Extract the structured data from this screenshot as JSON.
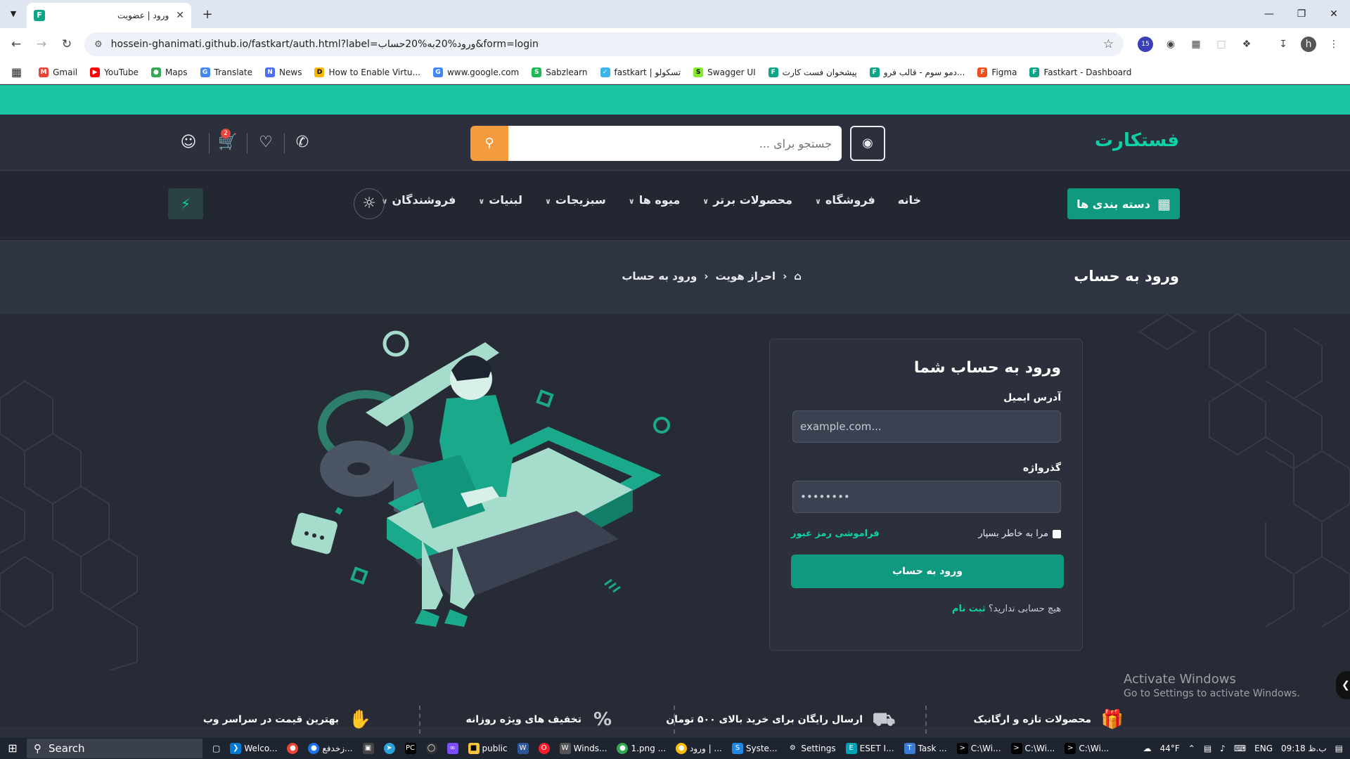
{
  "browser": {
    "tab_title": "ورود | عضویت",
    "tab_favicon": "F",
    "url": "hossein-ghanimati.github.io/fastkart/auth.html?label=ورود%20به%20حساب&form=login",
    "bookmarks": [
      "Gmail",
      "YouTube",
      "Maps",
      "Translate",
      "News",
      "How to Enable Virtu...",
      "www.google.com",
      "Sabzlearn",
      "fastkart | تسکولو",
      "Swagger UI",
      "پیشخوان فست کارت",
      "دمو سوم - قالب فرو...",
      "Figma",
      "Fastkart - Dashboard"
    ],
    "ext_badge": "15",
    "profile_initial": "h"
  },
  "header": {
    "logo": "فستکارت",
    "search_placeholder": "جستجو برای ...",
    "cart_count": "2"
  },
  "menu": {
    "categories_label": "دسته بندی ها",
    "items": [
      "خانه",
      "فروشگاه",
      "محصولات برتر",
      "میوه ها",
      "سبزیجات",
      "لبنیات",
      "فروشندگان"
    ]
  },
  "breadcrumb": {
    "title": "ورود به حساب",
    "level1": "احراز هویت",
    "level2": "ورود به حساب"
  },
  "login": {
    "heading": "ورود به حساب شما",
    "email_label": "آدرس ایمیل",
    "email_placeholder": "example.com...",
    "password_label": "گذرواژه",
    "password_value": "••••••••",
    "remember_label": "مرا به خاطر بسپار",
    "forgot_label": "فراموشی رمز عبور",
    "submit_label": "ورود به حساب",
    "no_account": "هیچ حسابی ندارید؟",
    "signup_label": "ثبت نام"
  },
  "features": [
    "محصولات تازه و ارگانیک",
    "ارسال رایگان برای خرید بالای ۵۰۰ تومان",
    "تخفیف های ویژه روزانه",
    "بهترین قیمت در سراسر وب"
  ],
  "watermark": {
    "line1": "Activate Windows",
    "line2": "Go to Settings to activate Windows."
  },
  "taskbar": {
    "search_label": "Search",
    "apps": [
      "Welco...",
      "زخدفع...",
      "public",
      "Winds...",
      "1.png ...",
      "ورود | ...",
      "Syste...",
      "Settings",
      "ESET I...",
      "Task ...",
      "C:\\Wi...",
      "C:\\Wi...",
      "C:\\Wi..."
    ],
    "temperature": "44°F",
    "language": "ENG",
    "clock": "09:18 ب.ظ"
  },
  "colors": {
    "accent": "#0f9a7f",
    "top_strip": "#1cc5a1",
    "search_button": "#f39b3d"
  }
}
